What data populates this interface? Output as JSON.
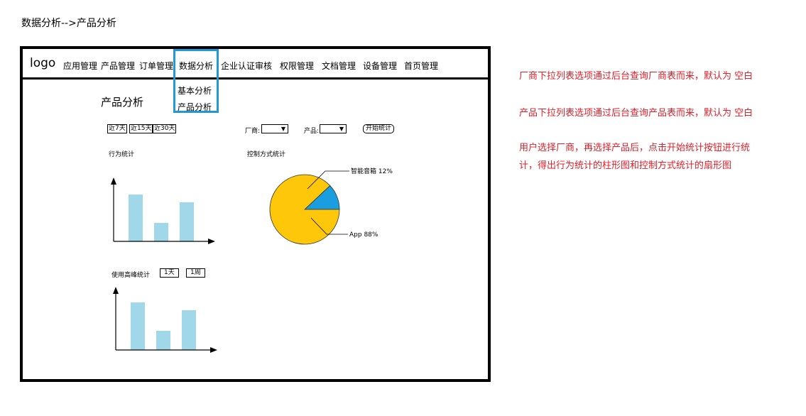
{
  "breadcrumb": "数据分析-->产品分析",
  "nav": {
    "logo": "logo",
    "items": [
      "应用管理",
      "产品管理",
      "订单管理",
      "数据分析",
      "企业认证审核",
      "权限管理",
      "文档管理",
      "设备管理",
      "首页管理"
    ],
    "active_index": 3,
    "dropdown": [
      "基本分析",
      "产品分析"
    ]
  },
  "page": {
    "title": "产品分析",
    "range_buttons": [
      "近7天",
      "近15天",
      "近30天"
    ],
    "vendor_label": "厂商:",
    "product_label": "产品:",
    "vendor_value": "",
    "product_value": "",
    "start_button": "开始统计"
  },
  "behavior_chart": {
    "title": "行为统计"
  },
  "peak_chart": {
    "title": "使用高峰统计",
    "buttons": [
      "1天",
      "1周"
    ]
  },
  "control_chart": {
    "title": "控制方式统计"
  },
  "notes": [
    "厂商下拉列表选项通过后台查询厂商表而来，默认为 空白",
    "产品下拉列表选项通过后台查询产品表而来，默认为 空白",
    "用户选择厂商，再选择产品后，点击开始统计按钮进行统",
    "计，得出行为统计的柱形图和控制方式统计的扇形图"
  ],
  "colors": {
    "bar": "#a0d8ea",
    "pie_major": "#fec70a",
    "pie_minor": "#1b9ee0",
    "nav_highlight": "#1f9ad6",
    "note": "#e0202a"
  },
  "chart_data": [
    {
      "type": "bar",
      "title": "行为统计",
      "categories": [
        "",
        "",
        ""
      ],
      "values": [
        66,
        26,
        55
      ],
      "ylim": [
        0,
        100
      ],
      "grid": false
    },
    {
      "type": "bar",
      "title": "使用高峰统计",
      "categories": [
        "",
        "",
        ""
      ],
      "values": [
        67,
        27,
        56
      ],
      "ylim": [
        0,
        100
      ],
      "grid": false
    },
    {
      "type": "pie",
      "title": "控制方式统计",
      "labels": [
        "智能音箱 12%",
        "App 88%"
      ],
      "values": [
        12,
        88
      ]
    }
  ]
}
